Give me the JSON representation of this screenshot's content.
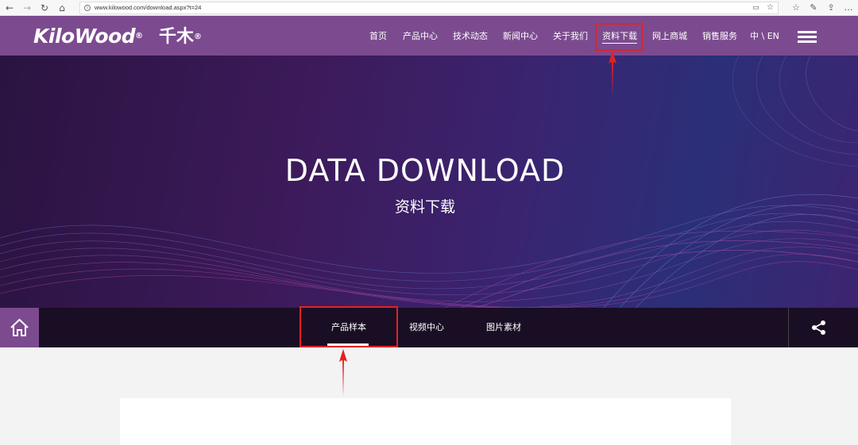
{
  "browser": {
    "url": "www.kilowood.com/download.aspx?t=24"
  },
  "header": {
    "logo_text": "KiloWood",
    "logo_cn": "千木",
    "reg_mark": "®",
    "nav": [
      {
        "label": "首页"
      },
      {
        "label": "产品中心"
      },
      {
        "label": "技术动态"
      },
      {
        "label": "新闻中心"
      },
      {
        "label": "关于我们"
      },
      {
        "label": "资料下载"
      },
      {
        "label": "网上商城"
      },
      {
        "label": "销售服务"
      }
    ],
    "lang": "中 \\ EN"
  },
  "hero": {
    "title": "DATA DOWNLOAD",
    "subtitle": "资料下载"
  },
  "subnav": {
    "tabs": [
      {
        "label": "产品样本"
      },
      {
        "label": "视频中心"
      },
      {
        "label": "图片素材"
      }
    ]
  },
  "colors": {
    "brand_purple": "#7c4b8f",
    "annotation_red": "#e32222"
  },
  "icons": [
    "back-icon",
    "forward-icon",
    "refresh-icon",
    "home-icon",
    "info-icon",
    "star-icon",
    "share-icon",
    "menu-icon"
  ]
}
